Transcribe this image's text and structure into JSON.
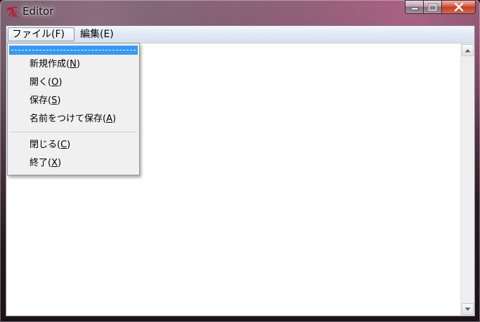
{
  "window": {
    "title": "Editor",
    "icon": "tk-feather-icon",
    "caption_buttons": [
      "minimize-icon",
      "maximize-icon",
      "close-icon"
    ]
  },
  "menubar": {
    "items": [
      {
        "label": "ファイル(F)"
      },
      {
        "label": "編集(E)"
      }
    ]
  },
  "file_menu": {
    "items": [
      {
        "label_prefix": "新規作成(",
        "accel": "N",
        "label_suffix": ")"
      },
      {
        "label_prefix": "開く(",
        "accel": "O",
        "label_suffix": ")"
      },
      {
        "label_prefix": "保存(",
        "accel": "S",
        "label_suffix": ")"
      },
      {
        "label_prefix": "名前をつけて保存(",
        "accel": "A",
        "label_suffix": ")"
      },
      {
        "label_prefix": "閉じる(",
        "accel": "C",
        "label_suffix": ")"
      },
      {
        "label_prefix": "終了(",
        "accel": "X",
        "label_suffix": ")"
      }
    ]
  },
  "colors": {
    "highlight": "#3399ff",
    "menu_bg": "#f0f0f0"
  }
}
